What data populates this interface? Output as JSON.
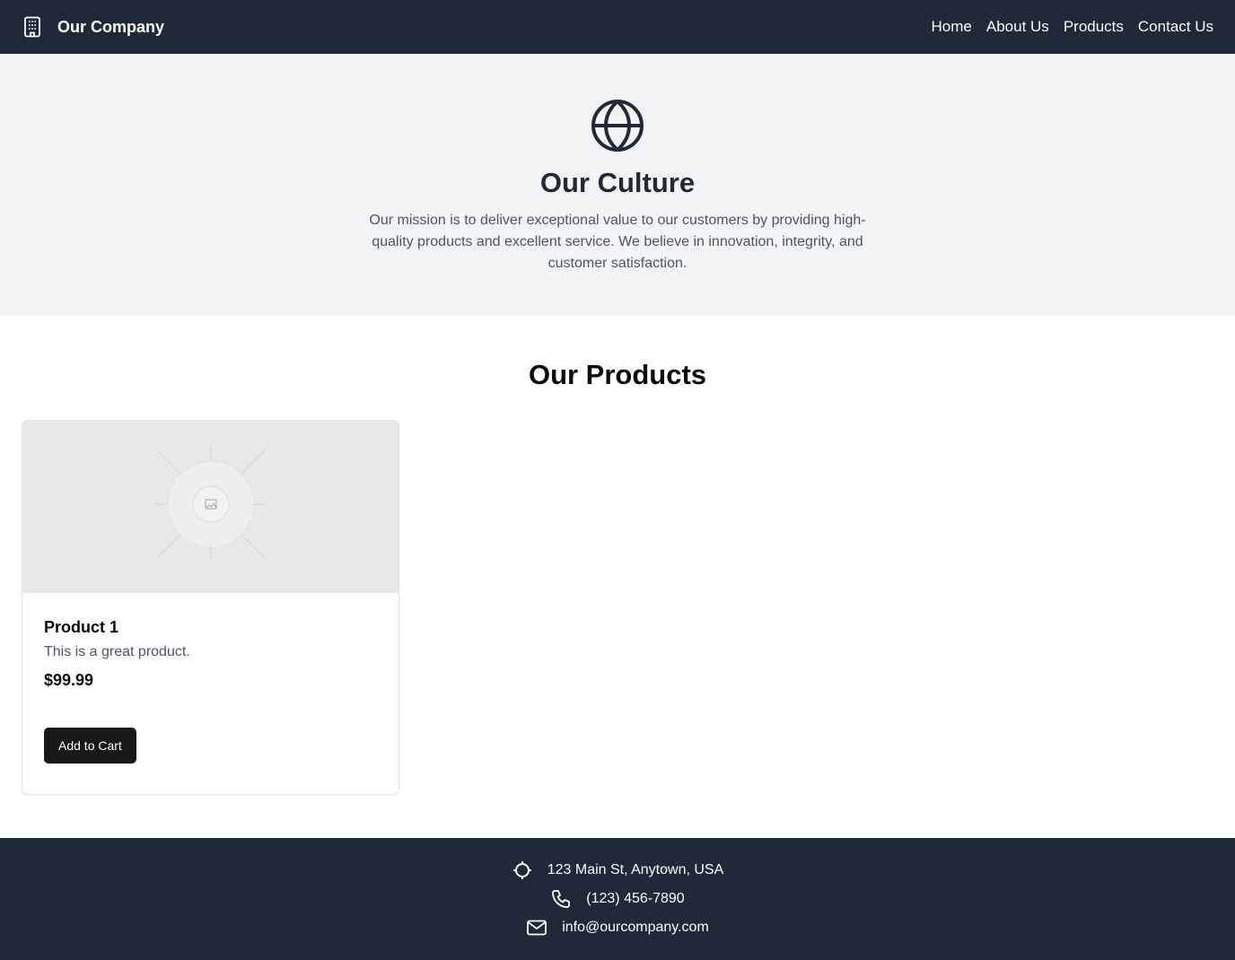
{
  "header": {
    "brand_icon": "building-icon",
    "brand_name": "Our Company",
    "nav": [
      "Home",
      "About Us",
      "Products",
      "Contact Us"
    ]
  },
  "hero": {
    "icon": "globe-icon",
    "title": "Our Culture",
    "text": "Our mission is to deliver exceptional value to our customers by providing high-quality products and excellent service. We believe in innovation, integrity, and customer satisfaction."
  },
  "products": {
    "title": "Our Products",
    "items": [
      {
        "image_icon": "image-placeholder-icon",
        "name": "Product 1",
        "description": "This is a great product.",
        "price": "$99.99",
        "button": "Add to Cart"
      }
    ]
  },
  "footer": {
    "address": {
      "icon": "location-crosshair-icon",
      "text": "123 Main St, Anytown, USA"
    },
    "phone": {
      "icon": "phone-icon",
      "text": "(123) 456-7890"
    },
    "email": {
      "icon": "mail-icon",
      "text": "info@ourcompany.com"
    }
  },
  "colors": {
    "dark": "#1f2937",
    "hero_bg": "#f3f4f6",
    "button": "#18181b"
  }
}
